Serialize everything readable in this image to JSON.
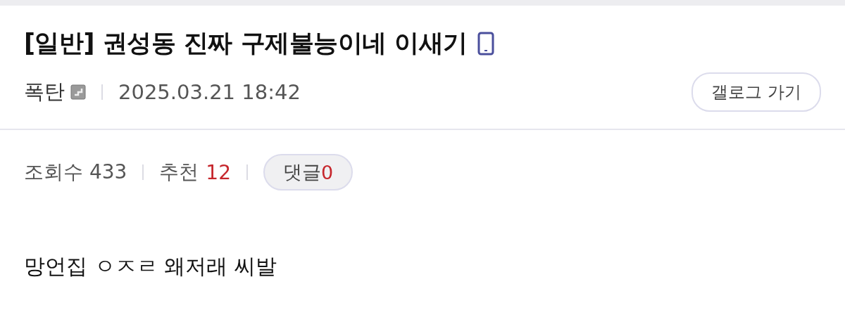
{
  "post": {
    "title": "[일반] 권성동 진짜 구제불능이네 이새기",
    "author": "폭탄",
    "date": "2025.03.21 18:42",
    "gallery_button": "갤로그 가기"
  },
  "stats": {
    "views_label": "조회수",
    "views": "433",
    "recommend_label": "추천",
    "recommend": "12",
    "comments_label": "댓글",
    "comments": "0"
  },
  "body": "망언집 ㅇㅈㄹ 왜저래 씨발"
}
